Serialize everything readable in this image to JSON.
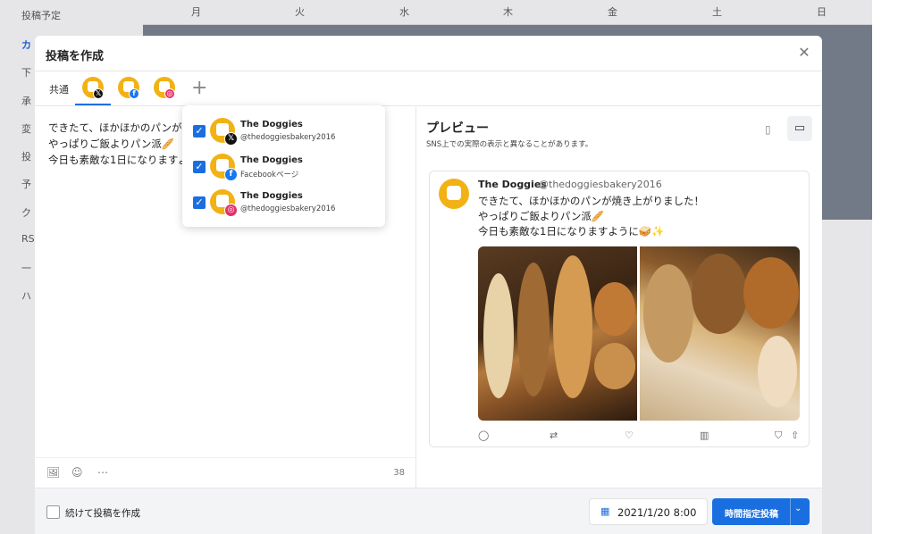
{
  "background": {
    "sidebar_title": "投稿予定",
    "sidebar_items": [
      "カ",
      "下",
      "承",
      "変",
      "投",
      "予",
      "ク",
      "RS",
      "一",
      "ハ"
    ],
    "calendar_days": [
      "月",
      "火",
      "水",
      "木",
      "金",
      "土",
      "日"
    ]
  },
  "modal": {
    "title": "投稿を作成",
    "close_icon": "close-icon"
  },
  "tabs": {
    "common_label": "共通",
    "accounts": [
      {
        "network": "x",
        "icon": "x-logo-icon"
      },
      {
        "network": "facebook",
        "icon": "facebook-logo-icon"
      },
      {
        "network": "instagram",
        "icon": "instagram-logo-icon"
      }
    ],
    "add_icon": "plus-icon"
  },
  "editor": {
    "text": "できたて、ほかほかのパンが\nやっぱりご飯よりパン派🥖\n今日も素敵な1日になりますよ",
    "char_count": "38",
    "tools": [
      "image-icon",
      "emoji-icon",
      "more-icon"
    ]
  },
  "account_dropdown": {
    "items": [
      {
        "name": "The Doggies",
        "handle": "@thedoggiesbakery2016",
        "network": "x",
        "checked": true
      },
      {
        "name": "The Doggies",
        "handle": "Facebookページ",
        "network": "facebook",
        "checked": true
      },
      {
        "name": "The Doggies",
        "handle": "@thedoggiesbakery2016",
        "network": "instagram",
        "checked": true
      }
    ]
  },
  "preview": {
    "title": "プレビュー",
    "subtitle": "SNS上での実際の表示と異なることがあります。",
    "device_toggle": [
      "mobile-icon",
      "desktop-icon"
    ],
    "card": {
      "name": "The Doggies",
      "handle": "@thedoggiesbakery2016",
      "text": "できたて、ほかほかのパンが焼き上がりました！\nやっぱりご飯よりパン派🥖\n今日も素敵な1日になりますように🥪✨",
      "images": [
        "bread-photo-1",
        "bread-photo-2"
      ],
      "actions": [
        "reply-icon",
        "retweet-icon",
        "like-icon",
        "stats-icon",
        "bookmark-icon",
        "share-icon"
      ]
    }
  },
  "footer": {
    "continue_label": "続けて投稿を作成",
    "continue_checked": false,
    "datetime": "2021/1/20 8:00",
    "submit_label": "時間指定投稿"
  },
  "colors": {
    "accent": "#1a6fe0",
    "avatar": "#f2b215"
  }
}
